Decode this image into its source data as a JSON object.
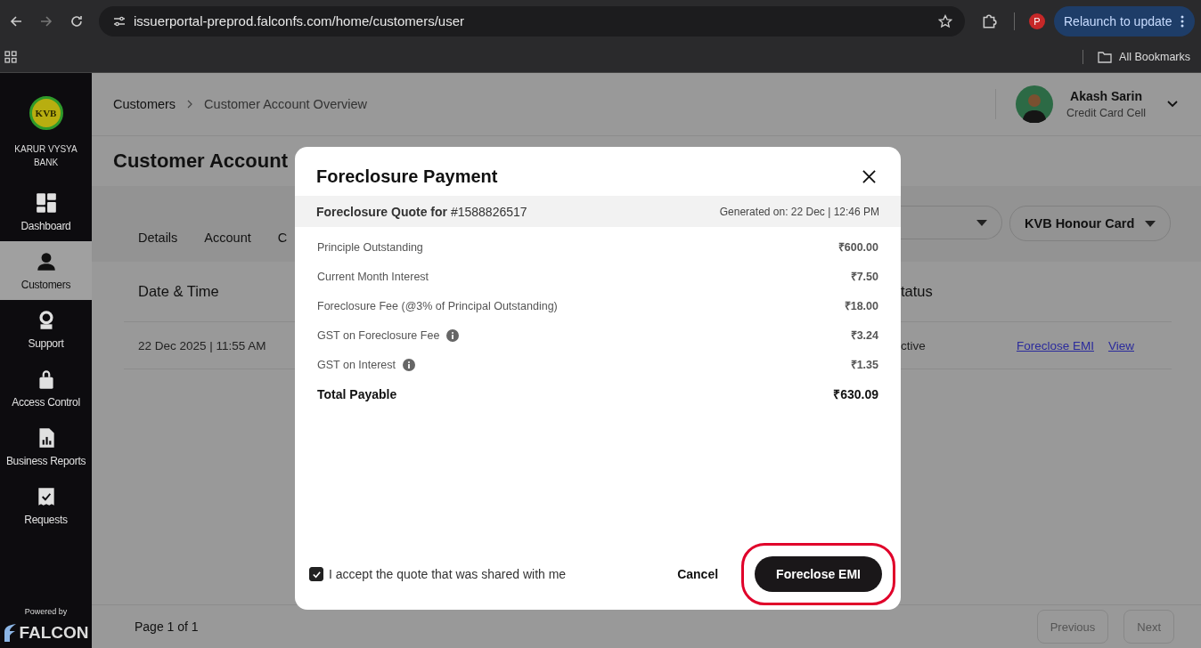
{
  "browser": {
    "url": "issuerportal-preprod.falconfs.com/home/customers/user",
    "profile_initial": "P",
    "relaunch": "Relaunch to update",
    "bookmarks": "All Bookmarks"
  },
  "sidebar": {
    "logo_text": "KVB",
    "bank_name": "KARUR VYSYA BANK",
    "items": [
      {
        "label": "Dashboard",
        "selected": false
      },
      {
        "label": "Customers",
        "selected": true
      },
      {
        "label": "Support",
        "selected": false
      },
      {
        "label": "Access Control",
        "selected": false
      },
      {
        "label": "Business Reports",
        "selected": false
      },
      {
        "label": "Requests",
        "selected": false
      }
    ],
    "powered_by": "Powered by",
    "brand": "FALCON"
  },
  "header": {
    "breadcrumb": [
      "Customers",
      "Customer Account Overview"
    ],
    "user": {
      "name": "Akash Sarin",
      "role": "Credit Card Cell"
    }
  },
  "page_title": "Customer Account",
  "tabs": [
    "Details",
    "Account",
    "C"
  ],
  "filter": "KVB Honour Card",
  "table": {
    "columns": [
      "Date & Time",
      "tatus"
    ],
    "rows": [
      {
        "cells": [
          "22 Dec 2025 | 11:55 AM",
          "ctive"
        ],
        "actions": [
          "Foreclose EMI",
          "View"
        ]
      }
    ]
  },
  "pagination": {
    "label": "Page 1 of 1",
    "buttons": [
      {
        "label": "Previous",
        "disabled": true
      },
      {
        "label": "Next",
        "disabled": true
      }
    ]
  },
  "modal": {
    "title": "Foreclosure Payment",
    "quote_label": "Foreclosure Quote for",
    "quote_id": "#1588826517",
    "generated": "Generated on: 22 Dec | 12:46 PM",
    "lines": [
      {
        "label": "Principle Outstanding",
        "value": "₹600.00",
        "info": false
      },
      {
        "label": "Current Month Interest",
        "value": "₹7.50",
        "info": false
      },
      {
        "label": "Foreclosure Fee (@3% of Principal Outstanding)",
        "value": "₹18.00",
        "info": false
      },
      {
        "label": "GST on Foreclosure Fee",
        "value": "₹3.24",
        "info": true
      },
      {
        "label": "GST on Interest",
        "value": "₹1.35",
        "info": true
      }
    ],
    "total": {
      "label": "Total Payable",
      "value": "₹630.09"
    },
    "accept": {
      "label": "I accept the quote that was shared with me",
      "checked": true
    },
    "cancel": "Cancel",
    "confirm": {
      "label": "Foreclose EMI",
      "highlighted": true
    }
  }
}
